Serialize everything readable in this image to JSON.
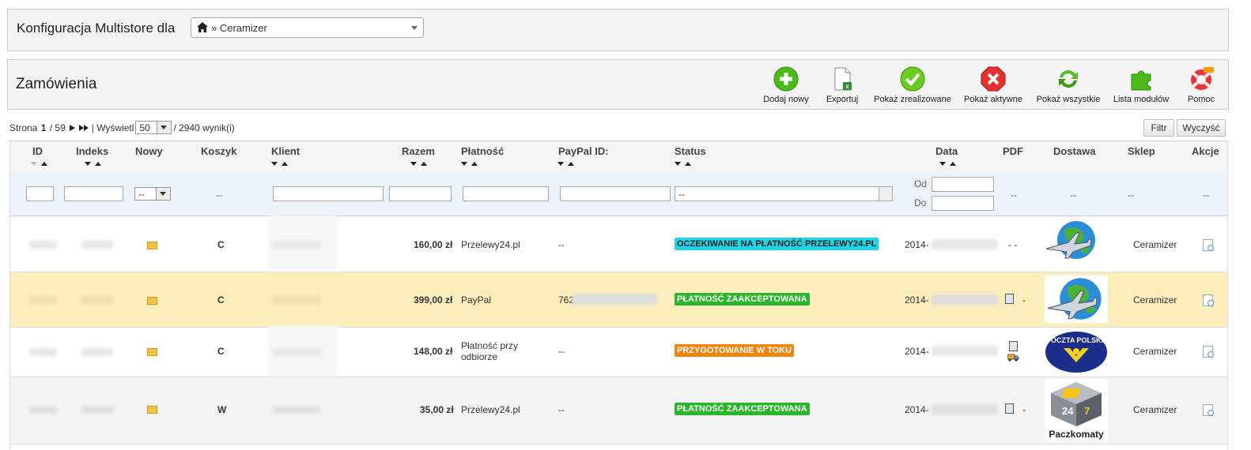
{
  "multistore": {
    "label": "Konfiguracja Multistore dla",
    "selected": "» Ceramizer"
  },
  "toolbar": {
    "title": "Zamówienia",
    "buttons": [
      {
        "label": "Dodaj nowy",
        "icon": "add-icon"
      },
      {
        "label": "Exportuj",
        "icon": "export-icon"
      },
      {
        "label": "Pokaż zrealizowane",
        "icon": "check-icon"
      },
      {
        "label": "Pokaż aktywne",
        "icon": "cross-icon"
      },
      {
        "label": "Pokaż wszystkie",
        "icon": "refresh-icon"
      },
      {
        "label": "Lista modułów",
        "icon": "puzzle-icon"
      },
      {
        "label": "Pomoc",
        "icon": "lifebuoy-icon"
      }
    ]
  },
  "pager": {
    "page_label": "Strona",
    "page": "1",
    "of": "/ 59",
    "show_label": "| Wyświetl",
    "per_page": "50",
    "total": "/ 2940 wynik(i)"
  },
  "filter_btn": "Filtr",
  "reset_btn": "Wyczyść",
  "table": {
    "headers": {
      "id": "ID",
      "index": "Indeks",
      "new": "Nowy",
      "cart": "Koszyk",
      "client": "Klient",
      "total": "Razem",
      "payment": "Płatność",
      "paypal": "PayPal ID:",
      "status": "Status",
      "date": "Data",
      "pdf": "PDF",
      "delivery": "Dostawa",
      "shop": "Sklep",
      "actions": "Akcje"
    },
    "filters": {
      "new_select": "--",
      "dash": "--",
      "status_select": "--",
      "from": "Od",
      "to": "Do"
    },
    "rows": [
      {
        "cart": "C",
        "total": "160,00 zł",
        "payment": "Przelewy24.pl",
        "paypal": "--",
        "status": "OCZEKIWANIE NA PŁATNOŚĆ PRZELEWY24.PL",
        "status_color": "#1ed5e8",
        "date": "2014-",
        "pdf": "- -",
        "shop": "Ceramizer",
        "delivery": "globe-plane",
        "delivery_label": ""
      },
      {
        "cart": "C",
        "total": "399,00 zł",
        "payment": "PayPal",
        "paypal": "762",
        "status": "PŁATNOŚĆ ZAAKCEPTOWANA",
        "status_color": "#2bb52b",
        "date": "2014-",
        "pdf": "-",
        "shop": "Ceramizer",
        "delivery": "globe-plane",
        "delivery_label": ""
      },
      {
        "cart": "C",
        "total": "148,00 zł",
        "payment": "Płatność przy odbiorze",
        "paypal": "--",
        "status": "PRZYGOTOWANIE W TOKU",
        "status_color": "#f08410",
        "date": "2014-",
        "pdf": "",
        "shop": "Ceramizer",
        "delivery": "poczta-polska",
        "delivery_label": "POCZTA POLSKA"
      },
      {
        "cart": "W",
        "total": "35,00 zł",
        "payment": "Przelewy24.pl",
        "paypal": "--",
        "status": "PŁATNOŚĆ ZAAKCEPTOWANA",
        "status_color": "#2bb52b",
        "date": "2014-",
        "pdf": "-",
        "shop": "Ceramizer",
        "delivery": "paczkomaty",
        "delivery_label": "Paczkomaty"
      }
    ]
  }
}
